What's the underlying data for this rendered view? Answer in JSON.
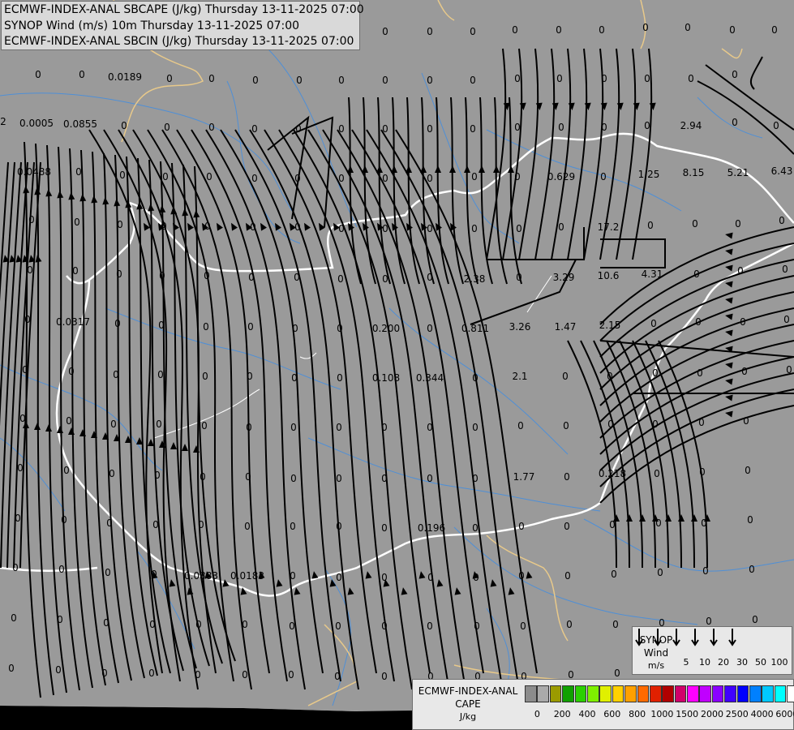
{
  "titles": {
    "line1": "ECMWF-INDEX-ANAL SBCAPE (J/kg) Thursday 13-11-2025 07:00",
    "line2": "SYNOP Wind (m/s) 10m Thursday 13-11-2025 07:00",
    "line3": "ECMWF-INDEX-ANAL SBCIN (J/kg) Thursday 13-11-2025 07:00"
  },
  "colors": {
    "background": "#9a9a9a",
    "river": "#4f8fd6",
    "border_national": "#ffffff",
    "border_region": "#e8c98a",
    "streamline": "#000000"
  },
  "synop_legend": {
    "title": "SYNOP",
    "subtitle": "Wind",
    "unit": "m/s",
    "barb_icon": "wind-barb-icon",
    "speeds": [
      "5",
      "10",
      "20",
      "30",
      "50",
      "100"
    ]
  },
  "cape_legend": {
    "title": "ECMWF-INDEX-ANAL",
    "subtitle": "CAPE",
    "unit": "J/kg",
    "colors": [
      "#8c8c8c",
      "#aaaaaa",
      "#9b9b00",
      "#11a000",
      "#2ad000",
      "#7ef000",
      "#e0f000",
      "#ffd000",
      "#ffa000",
      "#ff6a00",
      "#e02000",
      "#b00000",
      "#d0006a",
      "#ff00ff",
      "#c000ff",
      "#8a00ff",
      "#4000ff",
      "#0000ff",
      "#0080ff",
      "#00c8ff",
      "#00ffff",
      "#ffffff"
    ],
    "labels": [
      "0",
      "200",
      "400",
      "600",
      "800",
      "1000",
      "1500",
      "2000",
      "2500",
      "4000",
      "6000"
    ]
  },
  "values": [
    [
      "0",
      47,
      92
    ],
    [
      "0",
      101,
      92
    ],
    [
      "0.0189",
      154,
      95
    ],
    [
      "0",
      209,
      97
    ],
    [
      "0",
      261,
      97
    ],
    [
      "0",
      315,
      99
    ],
    [
      "0",
      369,
      99
    ],
    [
      "0",
      421,
      99
    ],
    [
      "0",
      475,
      99
    ],
    [
      "0",
      530,
      99
    ],
    [
      "0",
      583,
      99
    ],
    [
      "0",
      638,
      97
    ],
    [
      "0",
      690,
      97
    ],
    [
      "0",
      745,
      97
    ],
    [
      "0",
      798,
      97
    ],
    [
      "0",
      852,
      97
    ],
    [
      "0",
      906,
      92
    ],
    [
      "0",
      368,
      39
    ],
    [
      "0",
      421,
      39
    ],
    [
      "0",
      475,
      39
    ],
    [
      "0",
      530,
      39
    ],
    [
      "0",
      583,
      39
    ],
    [
      "0",
      635,
      37
    ],
    [
      "0",
      689,
      37
    ],
    [
      "0",
      742,
      37
    ],
    [
      "0",
      796,
      34
    ],
    [
      "0",
      848,
      34
    ],
    [
      "0",
      903,
      37
    ],
    [
      "0",
      955,
      37
    ],
    [
      "2",
      4,
      150
    ],
    [
      "0.0005",
      45,
      152
    ],
    [
      "0.0855",
      99,
      153
    ],
    [
      "0",
      153,
      155
    ],
    [
      "0",
      206,
      157
    ],
    [
      "0",
      261,
      157
    ],
    [
      "0",
      314,
      159
    ],
    [
      "0",
      368,
      159
    ],
    [
      "0",
      421,
      159
    ],
    [
      "0",
      475,
      159
    ],
    [
      "0",
      530,
      159
    ],
    [
      "0",
      583,
      159
    ],
    [
      "0",
      638,
      157
    ],
    [
      "0",
      692,
      157
    ],
    [
      "0",
      745,
      157
    ],
    [
      "0",
      798,
      155
    ],
    [
      "2.94",
      852,
      155
    ],
    [
      "0",
      906,
      151
    ],
    [
      "0",
      957,
      155
    ],
    [
      "0.0488",
      42,
      212
    ],
    [
      "0",
      97,
      212
    ],
    [
      "0",
      151,
      216
    ],
    [
      "0",
      204,
      218
    ],
    [
      "0",
      258,
      218
    ],
    [
      "0",
      314,
      220
    ],
    [
      "0",
      367,
      220
    ],
    [
      "0",
      421,
      220
    ],
    [
      "0",
      475,
      220
    ],
    [
      "0",
      530,
      220
    ],
    [
      "0",
      585,
      218
    ],
    [
      "0",
      638,
      218
    ],
    [
      "0.629",
      692,
      218
    ],
    [
      "0",
      744,
      218
    ],
    [
      "1.25",
      800,
      215
    ],
    [
      "8.15",
      855,
      213
    ],
    [
      "5.21",
      910,
      213
    ],
    [
      "6.43",
      964,
      211
    ],
    [
      "0",
      39,
      271
    ],
    [
      "0",
      95,
      274
    ],
    [
      "0",
      148,
      277
    ],
    [
      "0",
      202,
      279
    ],
    [
      "0",
      256,
      279
    ],
    [
      "0",
      312,
      280
    ],
    [
      "0",
      367,
      280
    ],
    [
      "0",
      421,
      282
    ],
    [
      "0",
      475,
      282
    ],
    [
      "0",
      530,
      282
    ],
    [
      "0",
      585,
      282
    ],
    [
      "0",
      640,
      282
    ],
    [
      "0",
      692,
      280
    ],
    [
      "17.2",
      750,
      280
    ],
    [
      "0",
      802,
      278
    ],
    [
      "0",
      857,
      276
    ],
    [
      "0",
      910,
      276
    ],
    [
      "0",
      964,
      272
    ],
    [
      "0",
      37,
      333
    ],
    [
      "0",
      93,
      334
    ],
    [
      "0",
      147,
      338
    ],
    [
      "0",
      200,
      340
    ],
    [
      "0",
      255,
      340
    ],
    [
      "0",
      310,
      342
    ],
    [
      "0",
      366,
      342
    ],
    [
      "0",
      420,
      344
    ],
    [
      "0",
      475,
      344
    ],
    [
      "0",
      530,
      342
    ],
    [
      "2.38",
      585,
      344
    ],
    [
      "0",
      640,
      342
    ],
    [
      "3.29",
      695,
      342
    ],
    [
      "10.6",
      750,
      340
    ],
    [
      "4.31",
      804,
      338
    ],
    [
      "0",
      859,
      338
    ],
    [
      "0",
      913,
      334
    ],
    [
      "0",
      968,
      332
    ],
    [
      "0",
      34,
      394
    ],
    [
      "0.0317",
      90,
      397
    ],
    [
      "0",
      145,
      399
    ],
    [
      "0",
      199,
      401
    ],
    [
      "0",
      254,
      403
    ],
    [
      "0",
      309,
      403
    ],
    [
      "0",
      364,
      405
    ],
    [
      "0",
      419,
      405
    ],
    [
      "0.200",
      476,
      405
    ],
    [
      "0",
      530,
      405
    ],
    [
      "0.811",
      586,
      405
    ],
    [
      "3.26",
      641,
      403
    ],
    [
      "1.47",
      697,
      403
    ],
    [
      "2.15",
      752,
      401
    ],
    [
      "0",
      806,
      399
    ],
    [
      "0",
      861,
      397
    ],
    [
      "0",
      916,
      397
    ],
    [
      "0",
      970,
      394
    ],
    [
      "0",
      31,
      456
    ],
    [
      "0",
      88,
      458
    ],
    [
      "0",
      143,
      462
    ],
    [
      "0",
      198,
      462
    ],
    [
      "0",
      253,
      464
    ],
    [
      "0",
      308,
      464
    ],
    [
      "0",
      363,
      466
    ],
    [
      "0",
      419,
      466
    ],
    [
      "0.108",
      476,
      466
    ],
    [
      "0.344",
      530,
      466
    ],
    [
      "0",
      586,
      466
    ],
    [
      "2.1",
      641,
      464
    ],
    [
      "0",
      697,
      464
    ],
    [
      "0",
      752,
      464
    ],
    [
      "0",
      808,
      460
    ],
    [
      "0",
      863,
      460
    ],
    [
      "0",
      918,
      458
    ],
    [
      "0",
      973,
      456
    ],
    [
      "0",
      28,
      516
    ],
    [
      "0",
      85,
      519
    ],
    [
      "0",
      140,
      523
    ],
    [
      "0",
      196,
      523
    ],
    [
      "0",
      252,
      525
    ],
    [
      "0",
      307,
      527
    ],
    [
      "0",
      362,
      527
    ],
    [
      "0",
      418,
      527
    ],
    [
      "0",
      474,
      527
    ],
    [
      "0",
      530,
      527
    ],
    [
      "0",
      586,
      527
    ],
    [
      "0",
      642,
      525
    ],
    [
      "0",
      698,
      525
    ],
    [
      "0",
      753,
      523
    ],
    [
      "0",
      808,
      523
    ],
    [
      "0",
      865,
      521
    ],
    [
      "0",
      920,
      519
    ],
    [
      "0",
      25,
      577
    ],
    [
      "0",
      82,
      580
    ],
    [
      "0",
      138,
      584
    ],
    [
      "0",
      194,
      586
    ],
    [
      "0",
      250,
      588
    ],
    [
      "0",
      306,
      588
    ],
    [
      "0",
      362,
      590
    ],
    [
      "0",
      418,
      590
    ],
    [
      "0",
      474,
      590
    ],
    [
      "0",
      530,
      590
    ],
    [
      "0",
      586,
      590
    ],
    [
      "1.77",
      646,
      588
    ],
    [
      "0",
      699,
      588
    ],
    [
      "0.218",
      755,
      584
    ],
    [
      "0",
      810,
      584
    ],
    [
      "0",
      866,
      582
    ],
    [
      "0",
      922,
      580
    ],
    [
      "0",
      22,
      639
    ],
    [
      "0",
      79,
      641
    ],
    [
      "0",
      135,
      645
    ],
    [
      "0",
      192,
      647
    ],
    [
      "0",
      248,
      647
    ],
    [
      "0",
      305,
      649
    ],
    [
      "0",
      361,
      649
    ],
    [
      "0",
      418,
      649
    ],
    [
      "0",
      474,
      651
    ],
    [
      "0.196",
      532,
      651
    ],
    [
      "0",
      586,
      651
    ],
    [
      "0",
      643,
      649
    ],
    [
      "0",
      699,
      649
    ],
    [
      "0",
      755,
      647
    ],
    [
      "0",
      812,
      645
    ],
    [
      "0",
      868,
      645
    ],
    [
      "0",
      925,
      641
    ],
    [
      "0",
      19,
      700
    ],
    [
      "0",
      76,
      702
    ],
    [
      "0",
      133,
      706
    ],
    [
      "0",
      190,
      708
    ],
    [
      "0.0883",
      248,
      710
    ],
    [
      "0.0183",
      305,
      710
    ],
    [
      "0",
      361,
      710
    ],
    [
      "0",
      418,
      712
    ],
    [
      "0",
      474,
      712
    ],
    [
      "0",
      531,
      712
    ],
    [
      "0",
      587,
      712
    ],
    [
      "0",
      643,
      710
    ],
    [
      "0",
      700,
      710
    ],
    [
      "0",
      757,
      708
    ],
    [
      "0",
      814,
      706
    ],
    [
      "0",
      870,
      704
    ],
    [
      "0",
      927,
      702
    ],
    [
      "0",
      17,
      762
    ],
    [
      "0",
      74,
      764
    ],
    [
      "0",
      131,
      768
    ],
    [
      "0",
      188,
      770
    ],
    [
      "0",
      245,
      770
    ],
    [
      "0",
      302,
      770
    ],
    [
      "0",
      360,
      772
    ],
    [
      "0",
      417,
      772
    ],
    [
      "0",
      474,
      772
    ],
    [
      "0",
      530,
      772
    ],
    [
      "0",
      588,
      772
    ],
    [
      "0",
      645,
      772
    ],
    [
      "0",
      702,
      770
    ],
    [
      "0",
      759,
      770
    ],
    [
      "0",
      816,
      768
    ],
    [
      "0",
      874,
      766
    ],
    [
      "0",
      931,
      764
    ],
    [
      "0",
      14,
      824
    ],
    [
      "0",
      72,
      826
    ],
    [
      "0",
      129,
      830
    ],
    [
      "0",
      187,
      830
    ],
    [
      "0",
      244,
      832
    ],
    [
      "0",
      302,
      832
    ],
    [
      "0",
      359,
      832
    ],
    [
      "0",
      416,
      834
    ],
    [
      "0",
      474,
      834
    ],
    [
      "0",
      531,
      834
    ],
    [
      "0",
      589,
      834
    ],
    [
      "0",
      646,
      834
    ],
    [
      "0",
      704,
      832
    ],
    [
      "0",
      761,
      830
    ],
    [
      "0",
      819,
      828
    ],
    [
      "0",
      876,
      828
    ],
    [
      "0",
      934,
      826
    ]
  ]
}
